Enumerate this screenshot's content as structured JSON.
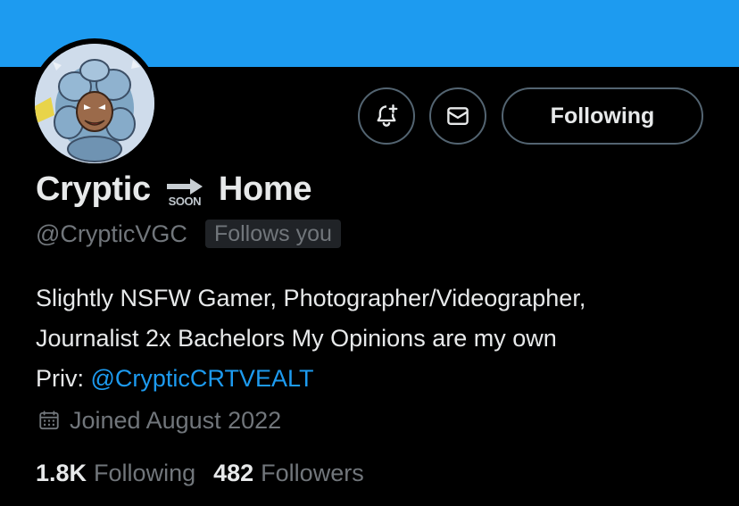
{
  "profile": {
    "name_part1": "Cryptic",
    "name_soon_text": "SOON",
    "name_part2": "Home",
    "handle": "@CrypticVGC",
    "follows_you_badge": "Follows you",
    "follow_button_label": "Following",
    "bio": {
      "line1": "Slightly NSFW Gamer, Photographer/Videographer,",
      "line2": "Journalist 2x Bachelors My Opinions are my own",
      "line3_prefix": "Priv: ",
      "line3_mention": "@CrypticCRTVEALT"
    },
    "joined": "Joined August 2022",
    "stats": {
      "following_count": "1.8K",
      "following_label": "Following",
      "followers_count": "482",
      "followers_label": "Followers"
    }
  },
  "icons": {
    "notify": "bell-plus-icon",
    "message": "envelope-icon",
    "soon": "soon-arrow-icon",
    "calendar": "calendar-icon"
  },
  "colors": {
    "banner": "#1d9bf0",
    "background": "#000000",
    "primary_text": "#e7e9ea",
    "secondary_text": "#71767b",
    "link": "#1d9bf0",
    "button_border": "#536471"
  }
}
